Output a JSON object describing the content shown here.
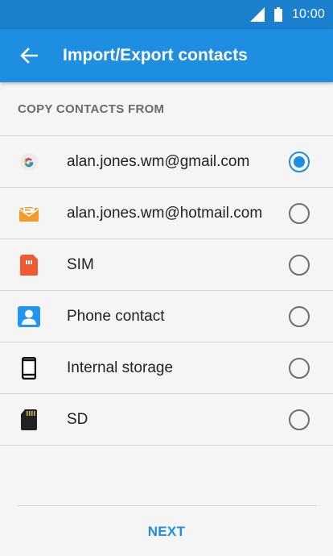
{
  "status_bar": {
    "time": "10:00",
    "signal_icon": "signal-icon",
    "battery_icon": "battery-icon"
  },
  "app_bar": {
    "title": "Import/Export contacts",
    "back_icon": "back-arrow-icon",
    "color": "#1e8ee0"
  },
  "section": {
    "header": "COPY CONTACTS FROM"
  },
  "sources": [
    {
      "label": "alan.jones.wm@gmail.com",
      "icon": "google-icon",
      "selected": true
    },
    {
      "label": "alan.jones.wm@hotmail.com",
      "icon": "email-icon",
      "selected": false
    },
    {
      "label": "SIM",
      "icon": "sim-card-icon",
      "selected": false
    },
    {
      "label": "Phone contact",
      "icon": "contact-icon",
      "selected": false
    },
    {
      "label": "Internal storage",
      "icon": "phone-storage-icon",
      "selected": false
    },
    {
      "label": "SD",
      "icon": "sd-card-icon",
      "selected": false
    }
  ],
  "footer": {
    "next_label": "NEXT"
  },
  "colors": {
    "accent": "#1e8ee0",
    "status_bar": "#1a7fcc"
  }
}
